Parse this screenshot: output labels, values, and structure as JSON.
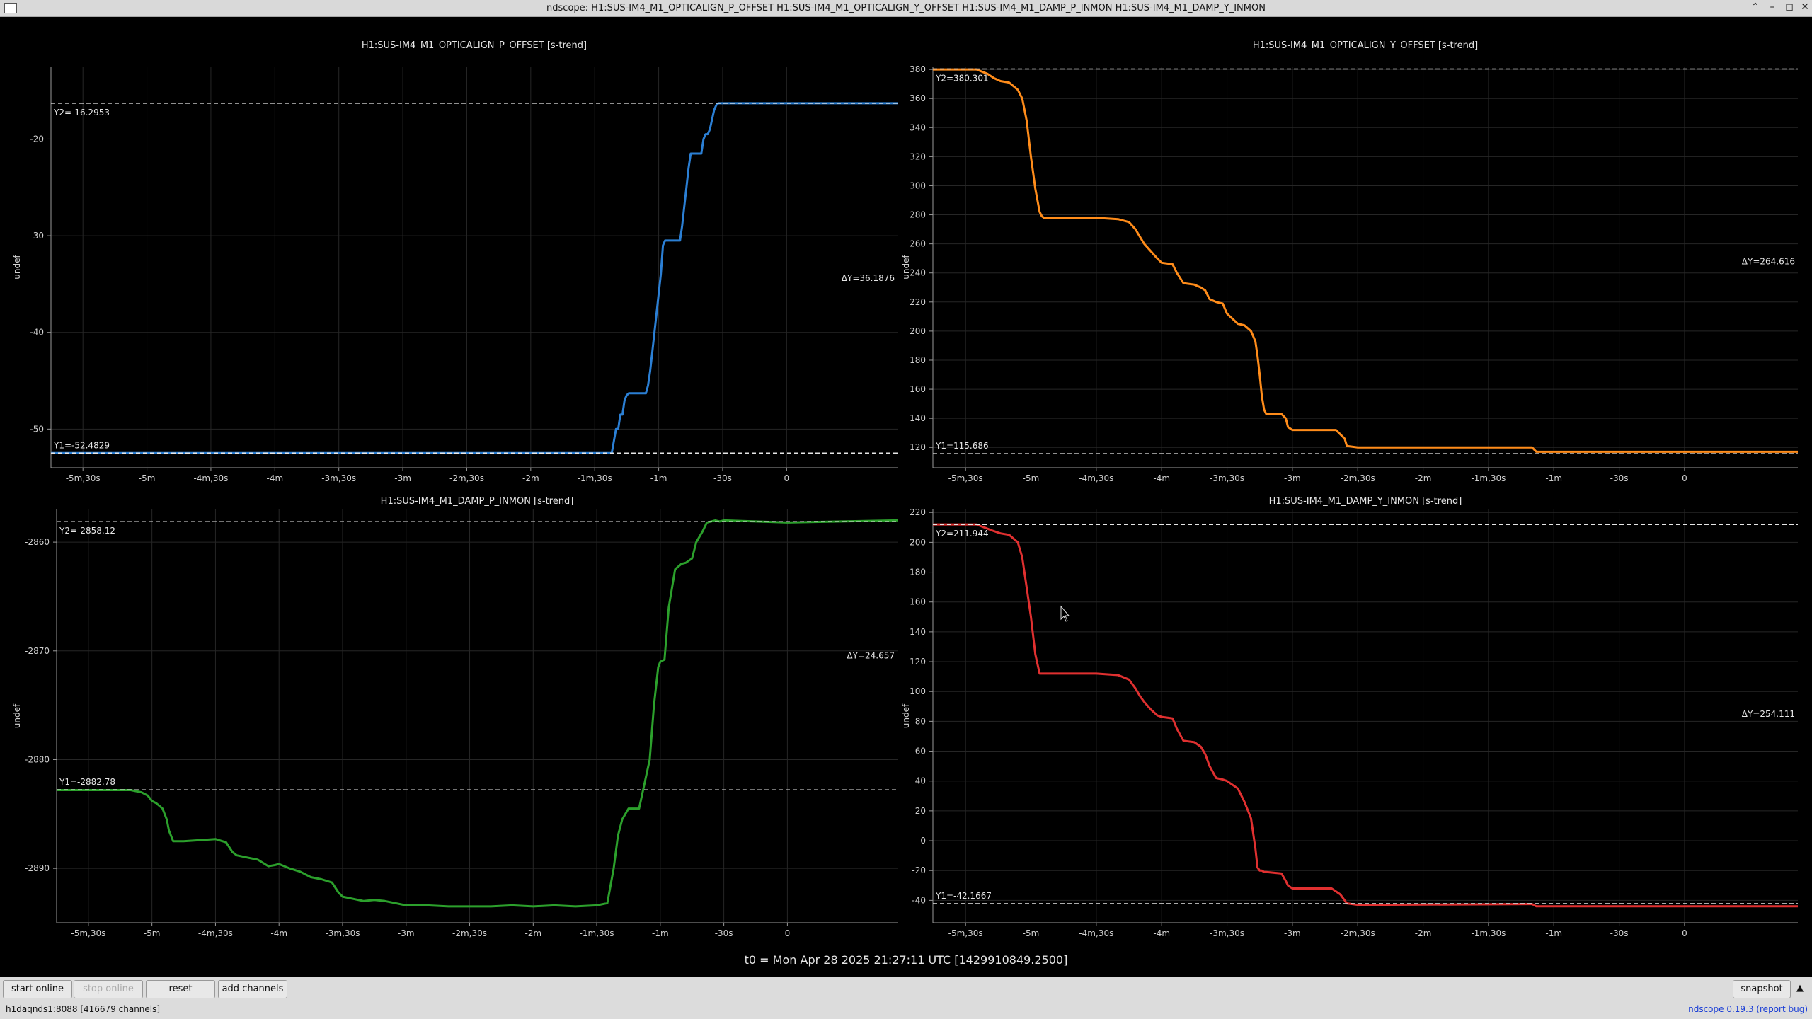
{
  "window": {
    "title": "ndscope: H1:SUS-IM4_M1_OPTICALIGN_P_OFFSET H1:SUS-IM4_M1_OPTICALIGN_Y_OFFSET H1:SUS-IM4_M1_DAMP_P_INMON H1:SUS-IM4_M1_DAMP_Y_INMON"
  },
  "t0_label": "t0 = Mon Apr 28 2025 21:27:11 UTC [1429910849.2500]",
  "toolbar": {
    "start_online": "start online",
    "stop_online": "stop online",
    "reset": "reset",
    "add_channels": "add channels",
    "snapshot": "snapshot"
  },
  "status": {
    "server": "h1daqnds1:8088  [416679 channels]",
    "version": "ndscope 0.19.3",
    "report_bug": "(report bug)"
  },
  "chart_data": [
    {
      "type": "line",
      "title": "H1:SUS-IM4_M1_OPTICALIGN_P_OFFSET [s-trend]",
      "ylabel": "undef",
      "color": "#2b7fd4",
      "xlim": [
        -345,
        52
      ],
      "ylim": [
        -54,
        -12.5
      ],
      "xticks": [
        -330,
        -300,
        -270,
        -240,
        -210,
        -180,
        -150,
        -120,
        -90,
        -60,
        -30,
        0
      ],
      "xticklabels": [
        "-5m,30s",
        "-5m",
        "-4m,30s",
        "-4m",
        "-3m,30s",
        "-3m",
        "-2m,30s",
        "-2m",
        "-1m,30s",
        "-1m",
        "-30s",
        "0"
      ],
      "yticks": [
        -50,
        -40,
        -30,
        -20
      ],
      "yticklabels": [
        "-50",
        "-40",
        "-30",
        "-20"
      ],
      "cursors": {
        "y1": -52.4829,
        "y2": -16.2953,
        "y1_label": "Y1=-52.4829",
        "y2_label": "Y2=-16.2953",
        "dy_label": "ΔY=36.1876"
      },
      "x": [
        -345,
        -82,
        -80,
        -79,
        -78,
        -77,
        -76,
        -75,
        -74,
        -73,
        -72,
        -66,
        -65,
        -64,
        -63,
        -62,
        -61,
        -60,
        -59,
        -58,
        -57,
        -56,
        -55,
        -51,
        -50,
        -49,
        -48,
        -47,
        -46,
        -45,
        -44,
        -43,
        -42,
        -41,
        -40,
        -39,
        -38,
        -37,
        -36,
        -35,
        -34,
        -33,
        -32,
        -31,
        -30,
        52
      ],
      "y": [
        -52.48,
        -52.48,
        -50,
        -50,
        -48.5,
        -48.5,
        -47,
        -46.5,
        -46.3,
        -46.3,
        -46.3,
        -46.3,
        -45.5,
        -44,
        -42,
        -40,
        -38,
        -36,
        -34,
        -31,
        -30.5,
        -30.5,
        -30.5,
        -30.5,
        -30.5,
        -29,
        -27,
        -25,
        -23,
        -21.5,
        -21.5,
        -21.5,
        -21.5,
        -21.5,
        -21.5,
        -20,
        -19.5,
        -19.5,
        -19,
        -18,
        -17,
        -16.5,
        -16.3,
        -16.3,
        -16.3,
        -16.3
      ]
    },
    {
      "type": "line",
      "title": "H1:SUS-IM4_M1_OPTICALIGN_Y_OFFSET [s-trend]",
      "ylabel": "undef",
      "color": "#ff8c1a",
      "xlim": [
        -345,
        52
      ],
      "ylim": [
        106,
        382
      ],
      "xticks": [
        -330,
        -300,
        -270,
        -240,
        -210,
        -180,
        -150,
        -120,
        -90,
        -60,
        -30,
        0
      ],
      "xticklabels": [
        "-5m,30s",
        "-5m",
        "-4m,30s",
        "-4m",
        "-3m,30s",
        "-3m",
        "-2m,30s",
        "-2m",
        "-1m,30s",
        "-1m",
        "-30s",
        "0"
      ],
      "yticks": [
        120,
        140,
        160,
        180,
        200,
        220,
        240,
        260,
        280,
        300,
        320,
        340,
        360,
        380
      ],
      "yticklabels": [
        "120",
        "140",
        "160",
        "180",
        "200",
        "220",
        "240",
        "260",
        "280",
        "300",
        "320",
        "340",
        "360",
        "380"
      ],
      "cursors": {
        "y1": 115.686,
        "y2": 380.301,
        "y1_label": "Y1=115.686",
        "y2_label": "Y2=380.301",
        "dy_label": "ΔY=264.616"
      },
      "x": [
        -345,
        -325,
        -320,
        -317,
        -314,
        -310,
        -306,
        -304,
        -302,
        -300,
        -298,
        -296,
        -295,
        -294,
        -288,
        -270,
        -260,
        -255,
        -252,
        -250,
        -248,
        -245,
        -242,
        -240,
        -235,
        -233,
        -230,
        -225,
        -222,
        -220,
        -218,
        -215,
        -212,
        -210,
        -205,
        -202,
        -199,
        -197,
        -196,
        -195,
        -194,
        -193,
        -192,
        -185,
        -183,
        -182,
        -180,
        -160,
        -156,
        -155,
        -150,
        -70,
        -68,
        52
      ],
      "y": [
        380,
        380,
        377,
        374,
        372,
        371,
        366,
        360,
        345,
        320,
        298,
        282,
        279,
        278,
        278,
        278,
        277,
        275,
        270,
        265,
        260,
        255,
        250,
        247,
        246,
        240,
        233,
        232,
        230,
        228,
        222,
        220,
        219,
        212,
        205,
        204,
        200,
        193,
        183,
        170,
        155,
        146,
        143,
        143,
        140,
        134,
        132,
        132,
        126,
        121,
        120,
        120,
        117,
        117
      ]
    },
    {
      "type": "line",
      "title": "H1:SUS-IM4_M1_DAMP_P_INMON [s-trend]",
      "ylabel": "undef",
      "color": "#2ca02c",
      "xlim": [
        -345,
        52
      ],
      "ylim": [
        -2895,
        -2857
      ],
      "xticks": [
        -330,
        -300,
        -270,
        -240,
        -210,
        -180,
        -150,
        -120,
        -90,
        -60,
        -30,
        0
      ],
      "xticklabels": [
        "-5m,30s",
        "-5m",
        "-4m,30s",
        "-4m",
        "-3m,30s",
        "-3m",
        "-2m,30s",
        "-2m",
        "-1m,30s",
        "-1m",
        "-30s",
        "0"
      ],
      "yticks": [
        -2890,
        -2880,
        -2870,
        -2860
      ],
      "yticklabels": [
        "-2890",
        "-2880",
        "-2870",
        "-2860"
      ],
      "cursors": {
        "y1": -2882.78,
        "y2": -2858.12,
        "y1_label": "Y1=-2882.78",
        "y2_label": "Y2=-2858.12",
        "dy_label": "ΔY=24.657"
      },
      "x": [
        -345,
        -320,
        -310,
        -305,
        -302,
        -300,
        -298,
        -295,
        -293,
        -292,
        -290,
        -285,
        -270,
        -265,
        -262,
        -260,
        -255,
        -250,
        -245,
        -242,
        -240,
        -235,
        -230,
        -225,
        -220,
        -215,
        -212,
        -210,
        -205,
        -200,
        -195,
        -190,
        -185,
        -180,
        -170,
        -160,
        -150,
        -140,
        -130,
        -120,
        -110,
        -100,
        -90,
        -85,
        -82,
        -80,
        -78,
        -75,
        -73,
        -70,
        -65,
        -63,
        -61,
        -60,
        -58,
        -56,
        -53,
        -50,
        -48,
        -45,
        -43,
        -40,
        -38,
        -36,
        -34,
        -32,
        -30,
        0,
        52
      ],
      "y": [
        -2882.8,
        -2882.8,
        -2882.8,
        -2883,
        -2883.3,
        -2883.8,
        -2884,
        -2884.5,
        -2885.5,
        -2886.5,
        -2887.5,
        -2887.5,
        -2887.3,
        -2887.6,
        -2888.5,
        -2888.8,
        -2889,
        -2889.2,
        -2889.8,
        -2889.7,
        -2889.6,
        -2890,
        -2890.3,
        -2890.8,
        -2891,
        -2891.3,
        -2892.2,
        -2892.6,
        -2892.8,
        -2893,
        -2892.9,
        -2893,
        -2893.2,
        -2893.4,
        -2893.4,
        -2893.5,
        -2893.5,
        -2893.5,
        -2893.4,
        -2893.5,
        -2893.4,
        -2893.5,
        -2893.4,
        -2893.2,
        -2890,
        -2887,
        -2885.5,
        -2884.5,
        -2884.5,
        -2884.5,
        -2880,
        -2875,
        -2871.5,
        -2871,
        -2870.8,
        -2866,
        -2862.5,
        -2862,
        -2861.9,
        -2861.5,
        -2860,
        -2859,
        -2858.2,
        -2858.1,
        -2858,
        -2858.1,
        -2858,
        -2858.2,
        -2858
      ]
    },
    {
      "type": "line",
      "title": "H1:SUS-IM4_M1_DAMP_Y_INMON [s-trend]",
      "ylabel": "undef",
      "color": "#e03030",
      "xlim": [
        -345,
        52
      ],
      "ylim": [
        -55,
        222
      ],
      "xticks": [
        -330,
        -300,
        -270,
        -240,
        -210,
        -180,
        -150,
        -120,
        -90,
        -60,
        -30,
        0
      ],
      "xticklabels": [
        "-5m,30s",
        "-5m",
        "-4m,30s",
        "-4m",
        "-3m,30s",
        "-3m",
        "-2m,30s",
        "-2m",
        "-1m,30s",
        "-1m",
        "-30s",
        "0"
      ],
      "yticks": [
        -40,
        -20,
        0,
        20,
        40,
        60,
        80,
        100,
        120,
        140,
        160,
        180,
        200,
        220
      ],
      "yticklabels": [
        "-40",
        "-20",
        "0",
        "20",
        "40",
        "60",
        "80",
        "100",
        "120",
        "140",
        "160",
        "180",
        "200",
        "220"
      ],
      "cursors": {
        "y1": -42.1667,
        "y2": 211.944,
        "y1_label": "Y1=-42.1667",
        "y2_label": "Y2=211.944",
        "dy_label": "ΔY=254.111"
      },
      "x": [
        -345,
        -325,
        -318,
        -314,
        -310,
        -306,
        -304,
        -302,
        -300,
        -298,
        -296,
        -295,
        -294,
        -288,
        -270,
        -260,
        -255,
        -252,
        -250,
        -248,
        -245,
        -242,
        -240,
        -235,
        -233,
        -230,
        -225,
        -222,
        -220,
        -218,
        -215,
        -212,
        -210,
        -205,
        -202,
        -199,
        -197,
        -196,
        -195,
        -194,
        -193,
        -192,
        -185,
        -183,
        -182,
        -180,
        -165,
        -162,
        -158,
        -156,
        -155,
        -150,
        -70,
        -68,
        -65,
        52
      ],
      "y": [
        212,
        212,
        208,
        206,
        205,
        200,
        190,
        170,
        150,
        125,
        112,
        112,
        112,
        112,
        112,
        111,
        108,
        102,
        97,
        93,
        88,
        84,
        83,
        82,
        75,
        67,
        66,
        63,
        58,
        50,
        42,
        41,
        40,
        35,
        26,
        15,
        -5,
        -18,
        -20,
        -20,
        -21,
        -21,
        -22,
        -27,
        -30,
        -32,
        -32,
        -32,
        -36,
        -40,
        -42,
        -43,
        -42.5,
        -44,
        -44,
        -44
      ]
    }
  ]
}
